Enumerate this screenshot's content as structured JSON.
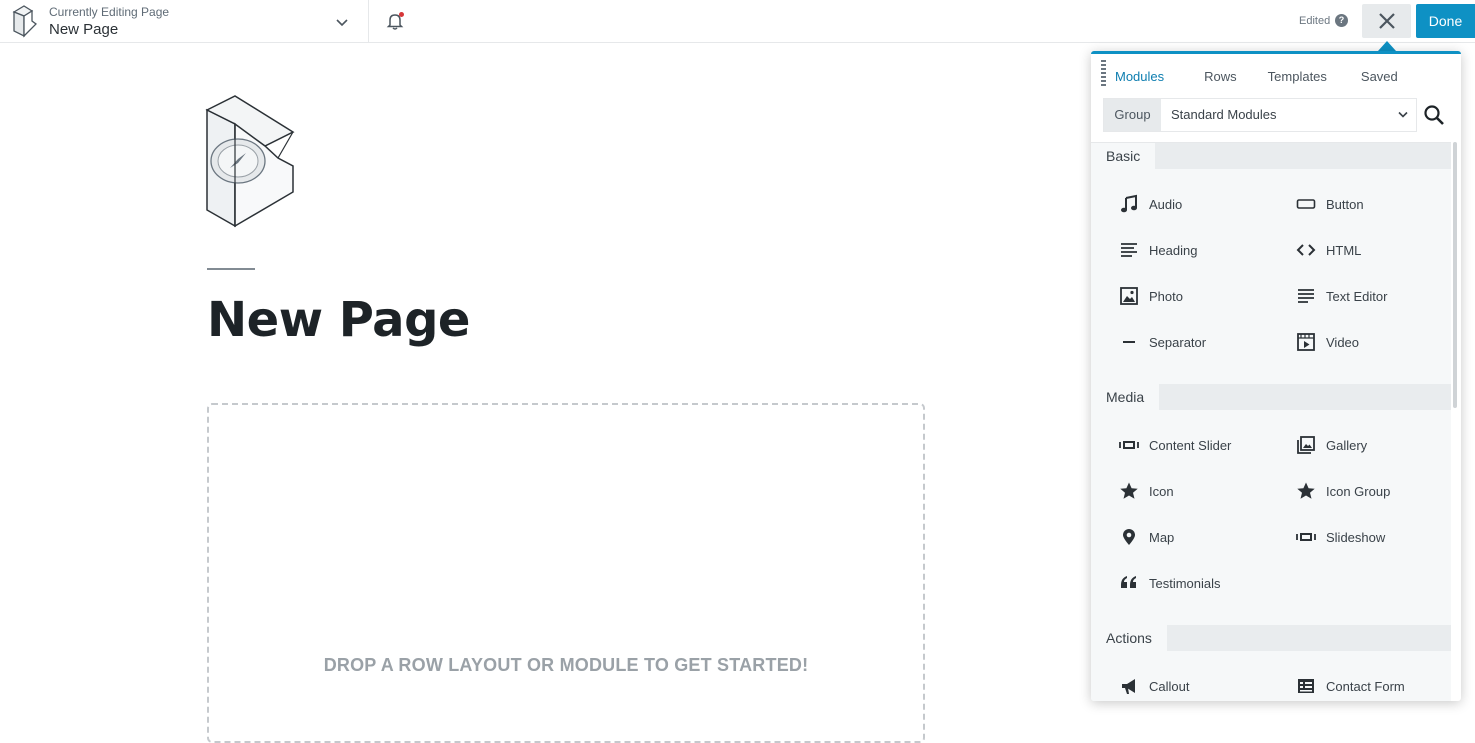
{
  "topbar": {
    "editing_label": "Currently Editing Page",
    "page_title": "New Page",
    "status": "Edited",
    "help": "?",
    "done_label": "Done"
  },
  "page": {
    "heading": "New Page",
    "dropzone_text": "DROP A ROW LAYOUT OR MODULE TO GET STARTED!"
  },
  "panel": {
    "tabs": [
      "Modules",
      "Rows",
      "Templates",
      "Saved"
    ],
    "group_label": "Group",
    "group_value": "Standard Modules",
    "sections": [
      {
        "title": "Basic",
        "modules": [
          {
            "label": "Audio",
            "icon": "music-note-icon"
          },
          {
            "label": "Button",
            "icon": "button-icon"
          },
          {
            "label": "Heading",
            "icon": "heading-icon"
          },
          {
            "label": "HTML",
            "icon": "code-icon"
          },
          {
            "label": "Photo",
            "icon": "photo-icon"
          },
          {
            "label": "Text Editor",
            "icon": "text-editor-icon"
          },
          {
            "label": "Separator",
            "icon": "separator-icon"
          },
          {
            "label": "Video",
            "icon": "video-icon"
          }
        ]
      },
      {
        "title": "Media",
        "modules": [
          {
            "label": "Content Slider",
            "icon": "slider-icon"
          },
          {
            "label": "Gallery",
            "icon": "gallery-icon"
          },
          {
            "label": "Icon",
            "icon": "star-icon"
          },
          {
            "label": "Icon Group",
            "icon": "star-icon"
          },
          {
            "label": "Map",
            "icon": "map-pin-icon"
          },
          {
            "label": "Slideshow",
            "icon": "slideshow-icon"
          },
          {
            "label": "Testimonials",
            "icon": "quote-icon"
          }
        ]
      },
      {
        "title": "Actions",
        "modules": [
          {
            "label": "Callout",
            "icon": "megaphone-icon"
          },
          {
            "label": "Contact Form",
            "icon": "form-icon"
          }
        ]
      }
    ]
  },
  "colors": {
    "accent": "#0e91c4",
    "active_tab": "#0e7eb0",
    "notification_dot": "#d63638"
  }
}
